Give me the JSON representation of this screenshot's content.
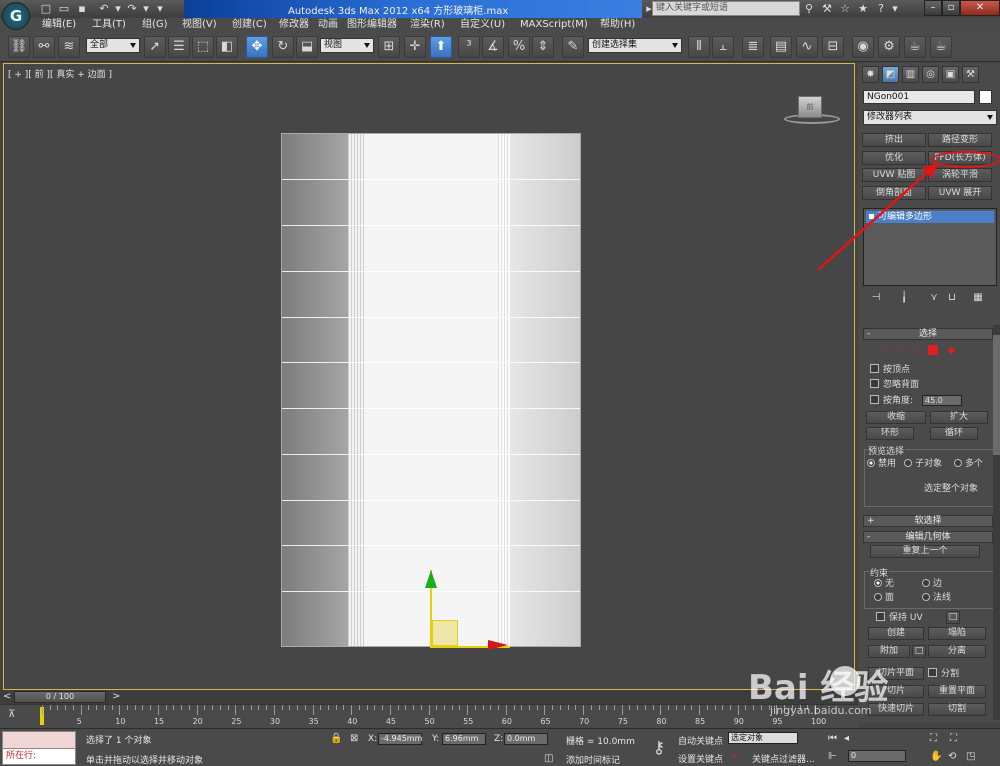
{
  "titlebar": {
    "logo": "G",
    "title": "Autodesk 3ds Max  2012 x64       方形玻璃柜.max",
    "search_placeholder": "键入关键字或短语"
  },
  "menu": [
    "编辑(E)",
    "工具(T)",
    "组(G)",
    "视图(V)",
    "创建(C)",
    "修改器",
    "动画",
    "图形编辑器",
    "渲染(R)",
    "自定义(U)",
    "MAXScript(M)",
    "帮助(H)"
  ],
  "toolbar": {
    "selection_filter": "全部",
    "ref_coord": "视图",
    "named_selection": "创建选择集"
  },
  "viewport": {
    "label": "[ + ][ 前 ][ 真实 + 边面 ]",
    "viewcube_label": "前"
  },
  "command_panel": {
    "object_name": "NGon001",
    "modifier_list": "修改器列表",
    "modifier_buttons": [
      "挤出",
      "路径变形",
      "优化",
      "FFD(长方体)",
      "UVW 贴图",
      "涡轮平滑",
      "倒角剖面",
      "UVW 展开"
    ],
    "stack_item": "可编辑多边形",
    "selection": {
      "header": "选择",
      "by_vertex": "按顶点",
      "ignore_backfacing": "忽略背面",
      "by_angle": "按角度:",
      "angle_value": "45.0",
      "shrink": "收缩",
      "grow": "扩大",
      "ring": "环形",
      "loop": "循环",
      "preview_selection": "预览选择",
      "preview_off": "禁用",
      "preview_subobj": "子对象",
      "preview_multi": "多个",
      "select_whole": "选定整个对象"
    },
    "soft_selection": "软选择",
    "edit_geometry": {
      "header": "编辑几何体",
      "repeat_last": "重复上一个",
      "constraints": "约束",
      "none": "无",
      "edge": "边",
      "face": "面",
      "normal": "法线",
      "preserve_uv": "保持 UV",
      "create": "创建",
      "collapse": "塌陷",
      "attach": "附加",
      "detach": "分离",
      "slice_plane": "切片平面",
      "split": "分割",
      "reset_plane": "重置平面",
      "quickslice": "快速切片",
      "cut": "切割"
    }
  },
  "timeline": {
    "frame": "0 / 100",
    "ticks": [
      "0",
      "5",
      "10",
      "15",
      "20",
      "25",
      "30",
      "35",
      "40",
      "45",
      "50",
      "55",
      "60",
      "65",
      "70",
      "75",
      "80",
      "85",
      "90",
      "95",
      "100"
    ]
  },
  "status": {
    "maxscript_line": "所在行:",
    "selected": "选择了 1 个对象",
    "prompt": "单击并拖动以选择并移动对象",
    "x_label": "X:",
    "x_value": "-4.945mm",
    "y_label": "Y:",
    "y_value": "6.96mm",
    "z_label": "Z:",
    "z_value": "0.0mm",
    "grid": "栅格 = 10.0mm",
    "add_time_tag": "添加时间标记",
    "auto_key": "自动关键点",
    "selected_object": "选定对象",
    "set_key": "设置关键点",
    "key_filters": "关键点过滤器...",
    "frame_field": "0"
  },
  "watermark": {
    "brand": "Bai  经验",
    "url": "jingyan.baidu.com"
  }
}
